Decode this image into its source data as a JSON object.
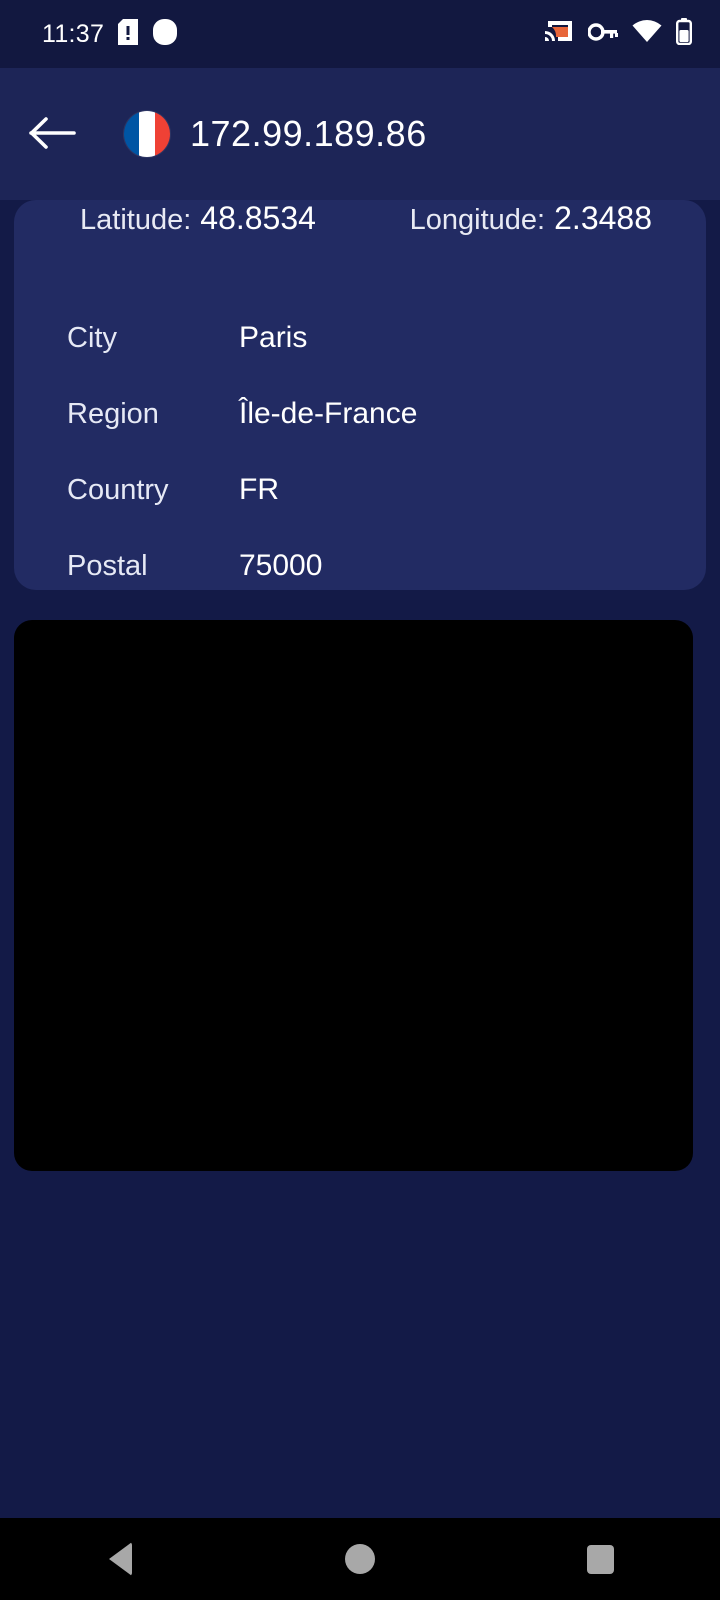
{
  "status_bar": {
    "time": "11:37",
    "icons": [
      "sim-card-alert-icon",
      "notification-dot-icon",
      "cast-icon",
      "vpn-key-icon",
      "wifi-icon",
      "battery-icon"
    ],
    "cast_color": "#E8663A",
    "background": "#121840"
  },
  "header": {
    "back_label": "back-arrow",
    "flag_country": "FR",
    "flag_colors": [
      "#0055A4",
      "#FFFFFF",
      "#EF4135"
    ],
    "title": "172.99.189.86",
    "background": "#1d2557"
  },
  "info_card": {
    "background": "#222b63",
    "coordinates": {
      "latitude_label": "Latitude:",
      "latitude_value": "48.8534",
      "longitude_label": "Longitude:",
      "longitude_value": "2.3488"
    },
    "details": [
      {
        "label": "City",
        "value": "Paris"
      },
      {
        "label": "Region",
        "value": "Île-de-France"
      },
      {
        "label": "Country",
        "value": "FR"
      },
      {
        "label": "Postal",
        "value": "75000"
      }
    ]
  },
  "map": {
    "background": "#000000",
    "content": ""
  },
  "nav_bar": {
    "background": "#000000",
    "icon_color": "#a8a8a8",
    "buttons": [
      "back-triangle",
      "home-circle",
      "recents-square"
    ]
  },
  "theme": {
    "page_background": "#131a47",
    "text_primary": "#ffffff",
    "text_secondary": "#e6e9f5"
  }
}
